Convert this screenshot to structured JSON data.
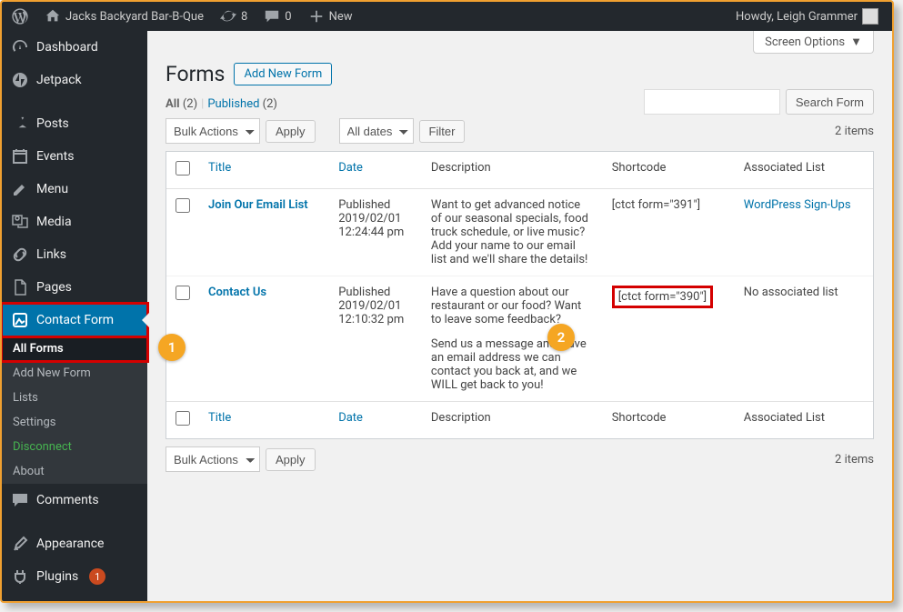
{
  "adminbar": {
    "site_name": "Jacks Backyard Bar-B-Que",
    "updates": "8",
    "comments": "0",
    "new_label": "New",
    "howdy": "Howdy, Leigh Grammer"
  },
  "sidebar": {
    "items": [
      {
        "label": "Dashboard"
      },
      {
        "label": "Jetpack"
      },
      {
        "label": "Posts"
      },
      {
        "label": "Events"
      },
      {
        "label": "Menu"
      },
      {
        "label": "Media"
      },
      {
        "label": "Links"
      },
      {
        "label": "Pages"
      },
      {
        "label": "Contact Form"
      },
      {
        "label": "Comments"
      },
      {
        "label": "Appearance"
      },
      {
        "label": "Plugins",
        "badge": "1"
      }
    ],
    "submenu": {
      "all_forms": "All Forms",
      "add_new": "Add New Form",
      "lists": "Lists",
      "settings": "Settings",
      "disconnect": "Disconnect",
      "about": "About"
    }
  },
  "content": {
    "screen_options": "Screen Options",
    "heading": "Forms",
    "add_new": "Add New Form",
    "filters": {
      "all": "All",
      "all_count": "(2)",
      "published": "Published",
      "published_count": "(2)"
    },
    "search": {
      "button": "Search Form"
    },
    "bulk_actions": "Bulk Actions",
    "apply": "Apply",
    "all_dates": "All dates",
    "filter": "Filter",
    "items_count": "2 items",
    "columns": {
      "title": "Title",
      "date": "Date",
      "description": "Description",
      "shortcode": "Shortcode",
      "associated": "Associated List"
    },
    "rows": [
      {
        "title": "Join Our Email List",
        "status": "Published",
        "date": "2019/02/01",
        "time": "12:24:44 pm",
        "description": "Want to get advanced notice of our seasonal specials, food truck schedule, or live music? Add your name to our email list and we'll share the details!",
        "shortcode": "[ctct form=\"391\"]",
        "associated": "WordPress Sign-Ups",
        "associated_is_link": true
      },
      {
        "title": "Contact Us",
        "status": "Published",
        "date": "2019/02/01",
        "time": "12:10:32 pm",
        "description_p1": "Have a question about our restaurant or our food? Want to leave some feedback?",
        "description_p2": "Send us a message and leave an email address we can contact you back at, and we WILL get back to you!",
        "shortcode": "[ctct form=\"390\"]",
        "associated": "No associated list",
        "associated_is_link": false
      }
    ]
  },
  "annotations": {
    "bubble1": "1",
    "bubble2": "2"
  }
}
